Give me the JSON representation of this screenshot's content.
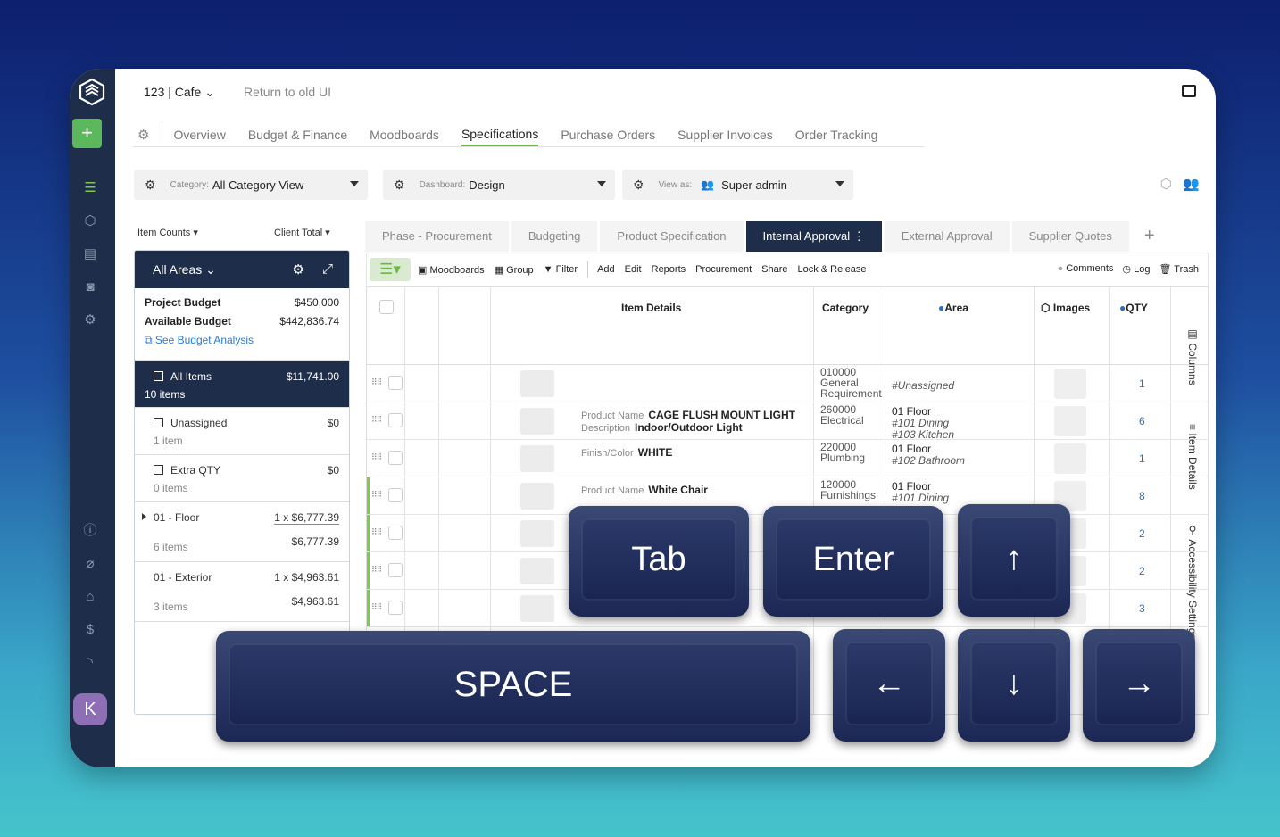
{
  "header": {
    "project": "123 | Cafe",
    "return_link": "Return to old UI"
  },
  "nav_tabs": [
    "Overview",
    "Budget & Finance",
    "Moodboards",
    "Specifications",
    "Purchase Orders",
    "Supplier Invoices",
    "Order Tracking"
  ],
  "filters": {
    "category_label": "Category:",
    "category_value": "All Category View",
    "dashboard_label": "Dashboard:",
    "dashboard_value": "Design",
    "viewas_label": "View as:",
    "viewas_value": "Super admin"
  },
  "left": {
    "item_counts": "Item Counts",
    "client_total": "Client Total",
    "all_areas": "All Areas",
    "project_budget_label": "Project Budget",
    "project_budget": "$450,000",
    "available_budget_label": "Available Budget",
    "available_budget": "$442,836.74",
    "see_budget": "See Budget Analysis",
    "areas": [
      {
        "name": "All Items",
        "amount": "$11,741.00",
        "sub": "10 items"
      },
      {
        "name": "Unassigned",
        "amount": "$0",
        "sub": "1 item"
      },
      {
        "name": "Extra QTY",
        "amount": "$0",
        "sub": "0 items"
      }
    ],
    "floors": [
      {
        "name": "01 - Floor",
        "amount1": "1 x $6,777.39",
        "amount2": "$6,777.39",
        "sub": "6 items"
      },
      {
        "name": "01 - Exterior",
        "amount1": "1 x $4,963.61",
        "amount2": "$4,963.61",
        "sub": "3 items"
      }
    ]
  },
  "phase_tabs": [
    "Phase - Procurement",
    "Budgeting",
    "Product Specification",
    "Internal Approval",
    "External Approval",
    "Supplier Quotes"
  ],
  "toolbar": {
    "moodboards": "Moodboards",
    "group": "Group",
    "filter": "Filter",
    "add": "Add",
    "edit": "Edit",
    "reports": "Reports",
    "procurement": "Procurement",
    "share": "Share",
    "lock": "Lock & Release",
    "comments": "Comments",
    "log": "Log",
    "trash": "Trash"
  },
  "grid": {
    "headers": {
      "item_details": "Item Details",
      "category": "Category",
      "area": "Area",
      "images": "Images",
      "qty": "QTY"
    },
    "rows": [
      {
        "pn_label": "",
        "pn_value": "",
        "desc_label": "",
        "desc_value": "",
        "cat1": "010000",
        "cat2": "General",
        "cat3": "Requirement",
        "area1": "",
        "area2": "#Unassigned",
        "area3": "",
        "qty": "1"
      },
      {
        "pn_label": "Product Name",
        "pn_value": "CAGE FLUSH MOUNT LIGHT",
        "desc_label": "Description",
        "desc_value": "Indoor/Outdoor Light",
        "cat1": "260000",
        "cat2": "Electrical",
        "cat3": "",
        "area1": "01 Floor",
        "area2": "#101 Dining",
        "area3": "#103 Kitchen",
        "qty": "6"
      },
      {
        "pn_label": "Finish/Color",
        "pn_value": "WHITE",
        "desc_label": "",
        "desc_value": "",
        "cat1": "220000",
        "cat2": "Plumbing",
        "cat3": "",
        "area1": "01 Floor",
        "area2": "#102 Bathroom",
        "area3": "",
        "qty": "1"
      },
      {
        "pn_label": "Product Name",
        "pn_value": "White Chair",
        "desc_label": "",
        "desc_value": "",
        "cat1": "120000",
        "cat2": "Furnishings",
        "cat3": "",
        "area1": "01 Floor",
        "area2": "#101 Dining",
        "area3": "",
        "qty": "8"
      },
      {
        "pn_label": "",
        "pn_value": "",
        "desc_label": "",
        "desc_value": "",
        "cat1": "",
        "cat2": "",
        "cat3": "",
        "area1": "",
        "area2": "",
        "area3": "",
        "qty": "2"
      },
      {
        "pn_label": "",
        "pn_value": "",
        "desc_label": "",
        "desc_value": "",
        "cat1": "",
        "cat2": "",
        "cat3": "",
        "area1": "",
        "area2": "",
        "area3": "",
        "qty": "2"
      },
      {
        "pn_label": "",
        "pn_value": "",
        "desc_label": "",
        "desc_value": "",
        "cat1": "",
        "cat2": "",
        "cat3": "",
        "area1": "",
        "area2": "",
        "area3": "",
        "qty": "3"
      }
    ]
  },
  "side_labels": [
    "Columns",
    "Item Details",
    "Accessibility Settings"
  ],
  "keys": {
    "tab": "Tab",
    "enter": "Enter",
    "up": "↑",
    "space": "SPACE",
    "left": "←",
    "down": "↓",
    "right": "→"
  },
  "avatar": "K"
}
